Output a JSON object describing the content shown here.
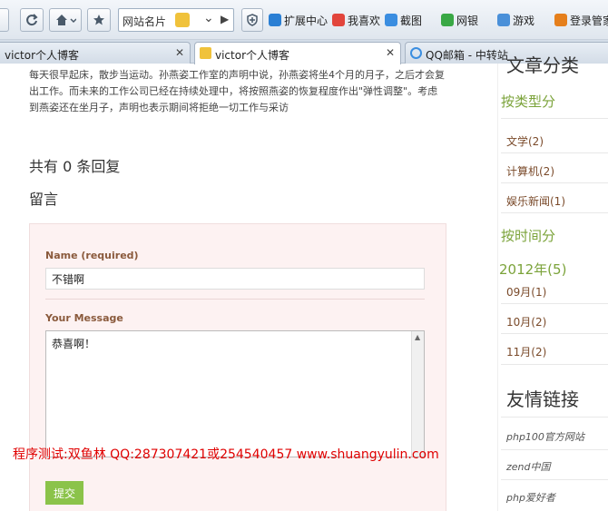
{
  "toolbar": {
    "url_text": "网站名片",
    "items": [
      {
        "label": "扩展中心",
        "color": "#2a7fd4"
      },
      {
        "label": "我喜欢",
        "color": "#e2453c"
      },
      {
        "label": "截图",
        "color": "#3a8de0"
      },
      {
        "label": "网银",
        "color": "#39a845"
      },
      {
        "label": "游戏",
        "color": "#4a90d9"
      },
      {
        "label": "登录管家",
        "color": "#e57f1c"
      }
    ]
  },
  "tabs": [
    {
      "label": "victor个人博客",
      "active": false
    },
    {
      "label": "victor个人博客",
      "active": true
    },
    {
      "label": "QQ邮箱 - 中转站",
      "active": false
    }
  ],
  "article": {
    "text": "每天很早起床，散步当运动。孙燕姿工作室的声明中说，孙燕姿将坐4个月的月子，之后才会复出工作。而未来的工作公司已经在持续处理中，将按照燕姿的恢复程度作出\"弹性调整\"。考虑到燕姿还在坐月子，声明也表示期间将拒绝一切工作与采访"
  },
  "comments": {
    "reply_count": "共有 0 条回复",
    "leave_message": "留言"
  },
  "form": {
    "name_label": "Name (required)",
    "name_value": "不错啊",
    "message_label": "Your Message",
    "message_value": "恭喜啊！",
    "submit_label": "提交"
  },
  "sidebar": {
    "heading_cut": "文章分类",
    "by_type": "按类型分",
    "categories": [
      "文学(2)",
      "计算机(2)",
      "娱乐新闻(1)"
    ],
    "by_time": "按时间分",
    "year": "2012年(5)",
    "months": [
      "09月(1)",
      "10月(2)",
      "11月(2)"
    ],
    "friend_heading": "友情链接",
    "friends": [
      "php100官方网站",
      "zend中国",
      "php爱好者"
    ]
  },
  "watermark": "程序测试:双鱼林 QQ:287307421或254540457  www.shuangyulin.com"
}
